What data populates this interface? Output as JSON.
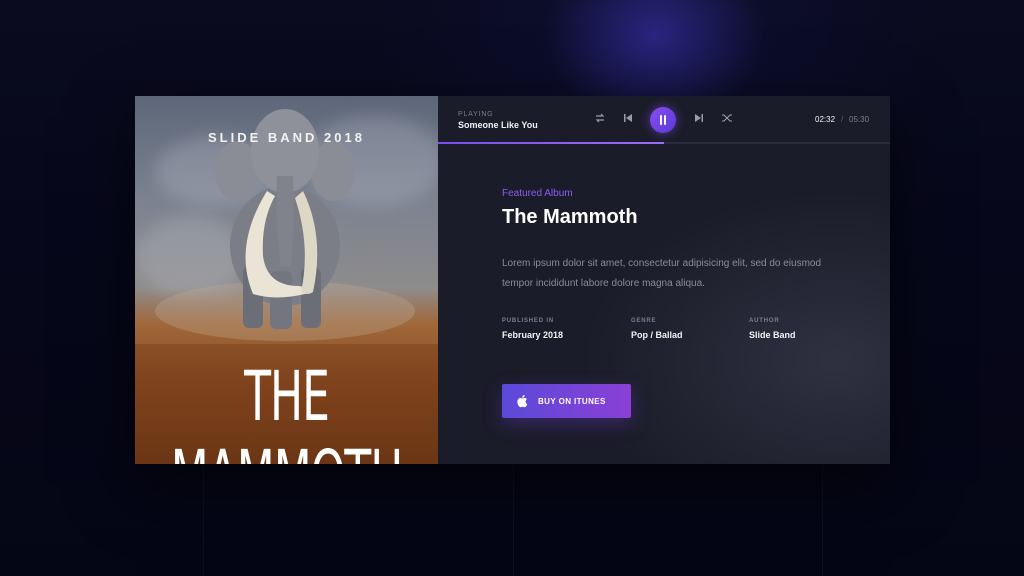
{
  "album_art": {
    "top_text": "SLIDE BAND 2018",
    "title_text": "THE MAMMOTH"
  },
  "player": {
    "status_label": "PLAYING",
    "song_title": "Someone Like You",
    "controls": [
      "repeat-icon",
      "previous-icon",
      "pause-icon",
      "next-icon",
      "shuffle-icon"
    ],
    "current_time": "02:32",
    "separator": "/",
    "total_time": "05:30",
    "progress_fraction": 0.5
  },
  "album": {
    "eyebrow": "Featured Album",
    "title": "The Mammoth",
    "description": "Lorem ipsum dolor sit amet, consectetur adipisicing elit, sed do eiusmod tempor incididunt labore dolore magna aliqua.",
    "meta": [
      {
        "label": "PUBLISHED IN",
        "value": "February 2018"
      },
      {
        "label": "GENRE",
        "value": "Pop / Ballad"
      },
      {
        "label": "AUTHOR",
        "value": "Slide Band"
      }
    ],
    "buy_label": "BUY ON ITUNES"
  },
  "colors": {
    "accent": "#8b5cf6",
    "card_bg": "#1b1c29",
    "page_bg": "#06071a"
  }
}
